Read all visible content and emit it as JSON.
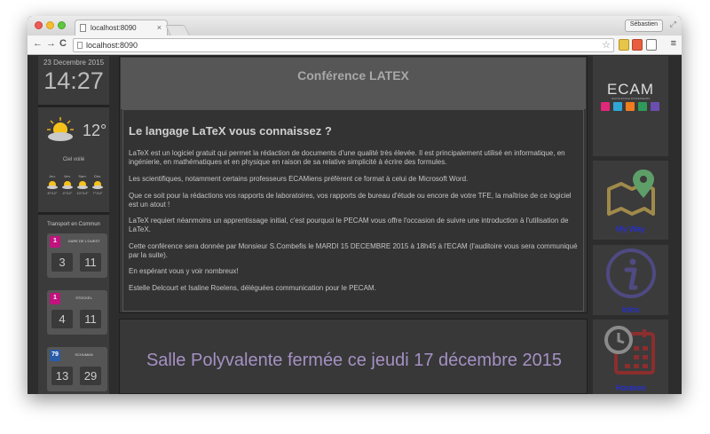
{
  "browser": {
    "tab_title": "localhost:8090",
    "tab_close": "×",
    "url": "localhost:8090",
    "user": "Sébastien",
    "back": "←",
    "forward": "→",
    "reload": "C",
    "menu": "≡",
    "star": "☆",
    "resize": "⤢"
  },
  "left": {
    "date": "23 Decembre 2015",
    "time": "14:27",
    "weather": {
      "temperature": "12°",
      "condition": "Ciel voilé",
      "forecast": [
        {
          "day": "Jeu.",
          "temps": "8°/12°"
        },
        {
          "day": "Ven.",
          "temps": "4°/12°"
        },
        {
          "day": "Sam.",
          "temps": "10°/14°"
        },
        {
          "day": "Dim.",
          "temps": "7°/14°"
        }
      ]
    },
    "transport": {
      "title": "Transport en Commun",
      "lines": [
        {
          "line": "1",
          "stop": "GARE DE L'OUEST",
          "color": "#c0137e",
          "next": [
            "3",
            "11"
          ]
        },
        {
          "line": "1",
          "stop": "STOCKEL",
          "color": "#c0137e",
          "next": [
            "4",
            "11"
          ]
        },
        {
          "line": "79",
          "stop": "SCHUMAN",
          "color": "#2a5ca8",
          "next": [
            "13",
            "29"
          ]
        }
      ]
    }
  },
  "main": {
    "header": "Conférence LATEX",
    "heading": "Le langage LaTeX vous connaissez ?",
    "paragraphs": [
      "LaTeX est un logiciel gratuit qui permet la rédaction de documents d'une qualité très élevée. Il est principalement utilisé en informatique, en ingénierie, en mathématiques et en physique en raison de sa relative simplicité à écrire des formules.",
      "Les scientifiques, notamment certains professeurs ECAMiens préfèrent ce format à celui de Microsoft Word.",
      "Que ce soit pour la rédactions vos rapports de laboratoires, vos rapports de bureau d'étude ou encore de votre TFE, la maîtrise de ce logiciel est un atout !",
      "LaTeX requiert néanmoins un apprentissage initial, c'est pourquoi le PECAM vous offre l'occasion de suivre une introduction à l'utilisation de LaTeX.",
      "Cette conférence sera donnée par Monsieur S.Combefis le MARDI 15 DECEMBRE 2015 à 18h45 à l'ECAM (l'auditoire vous sera communiqué par la suite).",
      "En espérant vous y voir nombreux!",
      "Estelle Delcourt et Isaline Roelens, déléguées communication pour le PECAM."
    ],
    "notice": "Salle Polyvalente fermée ce jeudi 17 décembre 2015"
  },
  "right": {
    "logo": "ECAM",
    "logo_sub": "HAUTE ECOLE D'INGENIEURS",
    "social_colors": [
      "#e0287a",
      "#2fa7d6",
      "#f07c1f",
      "#2f9a5a",
      "#6a4fb0"
    ],
    "tiles": [
      {
        "label": "My Way"
      },
      {
        "label": "Infos"
      },
      {
        "label": "Horaires"
      }
    ]
  },
  "colors": {
    "background": "#2d2d2d",
    "panel": "#3b3b3b",
    "link": "#1f2cff",
    "notice": "#a591c4"
  }
}
